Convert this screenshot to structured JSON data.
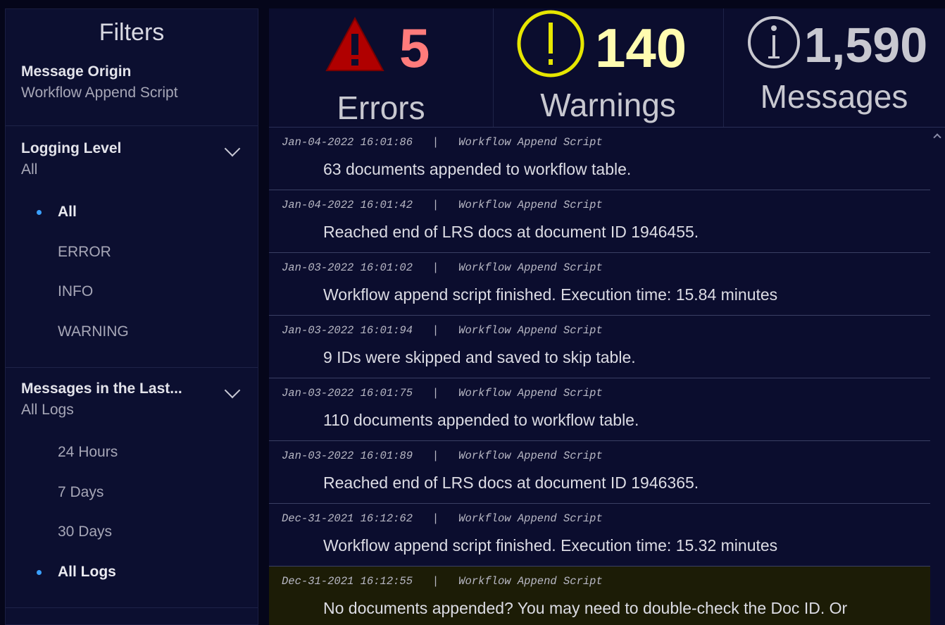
{
  "filters": {
    "title": "Filters",
    "message_origin": {
      "label": "Message Origin",
      "value": "Workflow Append Script"
    },
    "logging_level": {
      "label": "Logging Level",
      "value": "All",
      "options": [
        {
          "label": "All",
          "selected": true
        },
        {
          "label": "ERROR",
          "selected": false
        },
        {
          "label": "INFO",
          "selected": false
        },
        {
          "label": "WARNING",
          "selected": false
        }
      ]
    },
    "messages_last": {
      "label": "Messages in the Last...",
      "value": "All Logs",
      "options": [
        {
          "label": "24 Hours",
          "selected": false
        },
        {
          "label": "7 Days",
          "selected": false
        },
        {
          "label": "30 Days",
          "selected": false
        },
        {
          "label": "All Logs",
          "selected": true
        }
      ]
    }
  },
  "stats": {
    "errors": {
      "count": "5",
      "label": "Errors",
      "color": "#ff7b7b",
      "icon": "warning-triangle-icon"
    },
    "warnings": {
      "count": "140",
      "label": "Warnings",
      "color": "#fffbb0",
      "icon": "exclamation-circle-icon"
    },
    "messages": {
      "count": "1,590",
      "label": "Messages",
      "color": "#c8c8d0",
      "icon": "info-circle-icon"
    }
  },
  "logs": [
    {
      "timestamp": "Jan-04-2022 16:01:86",
      "source": "Workflow Append Script",
      "message": "63 documents appended to workflow table.",
      "level": "info"
    },
    {
      "timestamp": "Jan-04-2022 16:01:42",
      "source": "Workflow Append Script",
      "message": "Reached end of LRS docs at document ID 1946455.",
      "level": "info"
    },
    {
      "timestamp": "Jan-03-2022 16:01:02",
      "source": "Workflow Append Script",
      "message": "Workflow append script finished. Execution time: 15.84 minutes",
      "level": "info"
    },
    {
      "timestamp": "Jan-03-2022 16:01:94",
      "source": "Workflow Append Script",
      "message": "9 IDs were skipped and saved to skip table.",
      "level": "info"
    },
    {
      "timestamp": "Jan-03-2022 16:01:75",
      "source": "Workflow Append Script",
      "message": "110 documents appended to workflow table.",
      "level": "info"
    },
    {
      "timestamp": "Jan-03-2022 16:01:89",
      "source": "Workflow Append Script",
      "message": "Reached end of LRS docs at document ID 1946365.",
      "level": "info"
    },
    {
      "timestamp": "Dec-31-2021 16:12:62",
      "source": "Workflow Append Script",
      "message": "Workflow append script finished. Execution time: 15.32 minutes",
      "level": "info"
    },
    {
      "timestamp": "Dec-31-2021 16:12:55",
      "source": "Workflow Append Script",
      "message": "No documents appended? You may need to double-check the Doc ID. Or",
      "level": "warning"
    }
  ]
}
